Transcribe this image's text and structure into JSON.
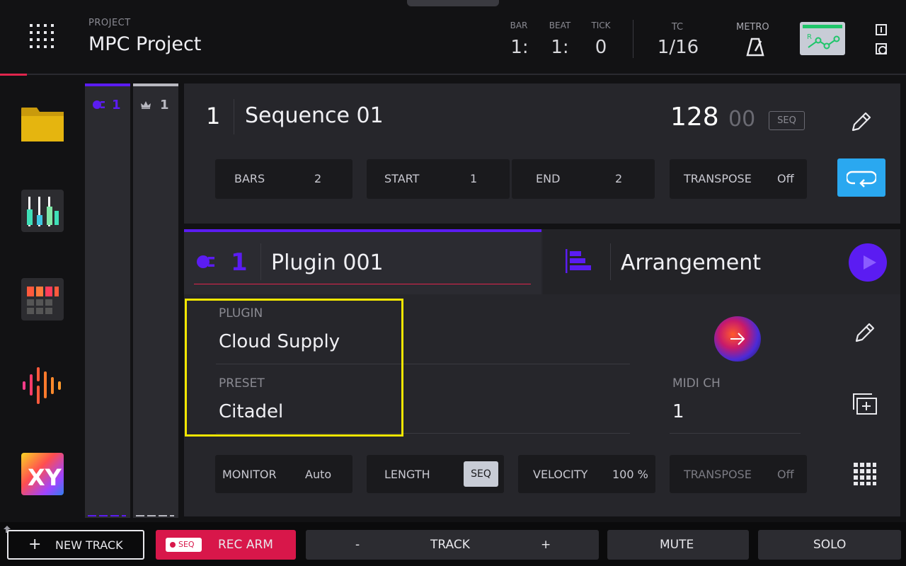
{
  "header": {
    "project_label": "PROJECT",
    "project_name": "MPC Project",
    "bar_label": "BAR",
    "bar_value": "1:",
    "beat_label": "BEAT",
    "beat_value": "1:",
    "tick_label": "TICK",
    "tick_value": "0",
    "tc_label": "TC",
    "tc_value": "1/16",
    "metro_label": "METRO",
    "automation_letter": "R"
  },
  "track_columns": [
    {
      "number": "1",
      "icon": "plugin-icon",
      "accent": "#5b1cf2"
    },
    {
      "number": "1",
      "icon": "crown-icon",
      "accent": "#b8b8c0"
    }
  ],
  "sequence": {
    "number": "1",
    "name": "Sequence 01",
    "bpm": "128",
    "bpm_decimal": "00",
    "bpm_source": "SEQ",
    "fields": {
      "bars_label": "BARS",
      "bars_value": "2",
      "start_label": "START",
      "start_value": "1",
      "end_label": "END",
      "end_value": "2",
      "transpose_label": "TRANSPOSE",
      "transpose_value": "Off"
    }
  },
  "track": {
    "number": "1",
    "name": "Plugin 001",
    "arrangement_label": "Arrangement",
    "plugin_label": "PLUGIN",
    "plugin_value": "Cloud Supply",
    "preset_label": "PRESET",
    "preset_value": "Citadel",
    "midi_ch_label": "MIDI CH",
    "midi_ch_value": "1",
    "fields": {
      "monitor_label": "MONITOR",
      "monitor_value": "Auto",
      "length_label": "LENGTH",
      "length_value": "SEQ",
      "velocity_label": "VELOCITY",
      "velocity_value": "100 %",
      "transpose_label": "TRANSPOSE",
      "transpose_value": "Off"
    }
  },
  "bottom_bar": {
    "new_track": "NEW TRACK",
    "rec_arm_badge": "SEQ",
    "rec_arm": "REC ARM",
    "track_minus": "-",
    "track": "TRACK",
    "track_plus": "+",
    "mute": "MUTE",
    "solo": "SOLO"
  },
  "colors": {
    "accent_purple": "#5b1cf2",
    "loop_blue": "#2aa8f0",
    "rec_red": "#d8174a",
    "highlight_yellow": "#f2e600"
  }
}
